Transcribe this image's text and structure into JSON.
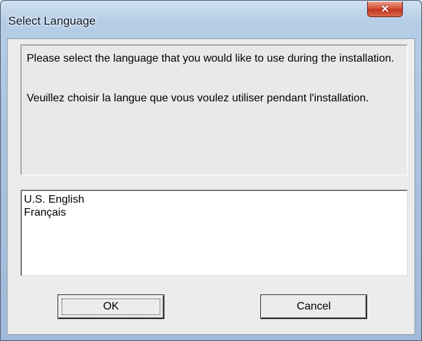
{
  "window": {
    "title": "Select Language",
    "close_glyph": "✕"
  },
  "message": {
    "english": "Please select the language that you would like to use during the installation.",
    "french": "Veuillez choisir la langue que vous voulez utiliser pendant l'installation."
  },
  "languages": {
    "items": [
      {
        "label": "U.S. English"
      },
      {
        "label": "Français"
      }
    ]
  },
  "buttons": {
    "ok_label": "OK",
    "cancel_label": "Cancel"
  },
  "colors": {
    "title_bar": "#a9c3df",
    "close_button": "#c2371e",
    "dialog_face": "#ececec"
  }
}
